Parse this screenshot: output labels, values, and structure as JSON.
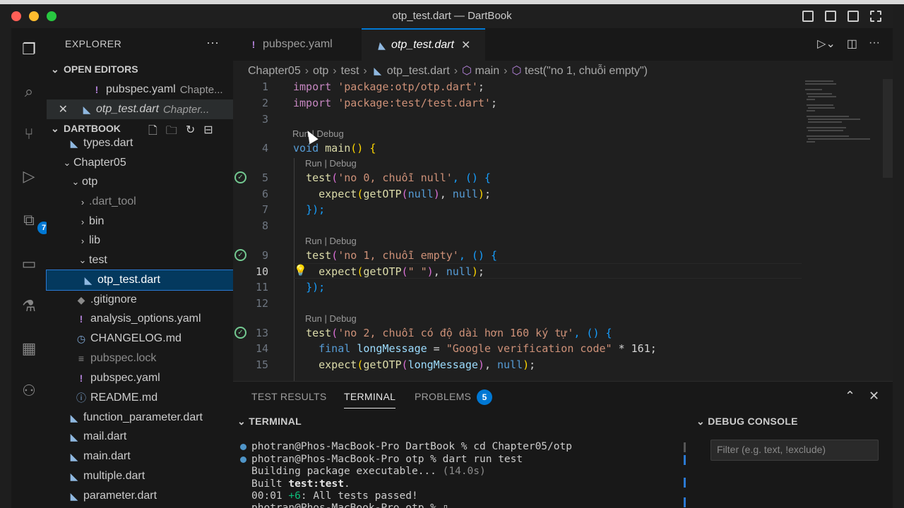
{
  "window": {
    "title": "otp_test.dart — DartBook"
  },
  "activity": {
    "extensions_badge": "7"
  },
  "sidebar": {
    "header": "EXPLORER",
    "more": "···",
    "open_editors_label": "OPEN EDITORS",
    "open_editors": [
      {
        "name": "pubspec.yaml",
        "desc": "Chapte..."
      },
      {
        "name": "otp_test.dart",
        "desc": "Chapter..."
      }
    ],
    "workspace_label": "DARTBOOK",
    "tree": [
      {
        "name": "types.dart"
      },
      {
        "name": "Chapter05"
      },
      {
        "name": "otp"
      },
      {
        "name": ".dart_tool"
      },
      {
        "name": "bin"
      },
      {
        "name": "lib"
      },
      {
        "name": "test"
      },
      {
        "name": "otp_test.dart"
      },
      {
        "name": ".gitignore"
      },
      {
        "name": "analysis_options.yaml"
      },
      {
        "name": "CHANGELOG.md"
      },
      {
        "name": "pubspec.lock"
      },
      {
        "name": "pubspec.yaml"
      },
      {
        "name": "README.md"
      },
      {
        "name": "function_parameter.dart"
      },
      {
        "name": "mail.dart"
      },
      {
        "name": "main.dart"
      },
      {
        "name": "multiple.dart"
      },
      {
        "name": "parameter.dart"
      }
    ]
  },
  "editor": {
    "tabs": [
      {
        "label": "pubspec.yaml"
      },
      {
        "label": "otp_test.dart"
      }
    ],
    "breadcrumbs": [
      "Chapter05",
      "otp",
      "test",
      "otp_test.dart",
      "main",
      "test(\"no 1, chuỗi empty\")"
    ],
    "codelens": "Run | Debug",
    "line_numbers": [
      "1",
      "2",
      "3",
      "4",
      "5",
      "6",
      "7",
      "8",
      "9",
      "10",
      "11",
      "12",
      "13",
      "14",
      "15"
    ],
    "code": {
      "l1_kw": "import",
      "l1_str": "'package:otp/otp.dart'",
      "l1_end": ";",
      "l2_kw": "import",
      "l2_str": "'package:test/test.dart'",
      "l2_end": ";",
      "l4_kw": "void",
      "l4_fn": "main",
      "l4_rest": "() {",
      "l5_fn": "test",
      "l5_str": "'no 0, chuỗi null'",
      "l5_rest": ", () {",
      "l6_fn": "expect",
      "l6_fn2": "getOTP",
      "l6_a": "null",
      "l6_b": "null",
      "l6_end": ";",
      "l7": "});",
      "l9_fn": "test",
      "l9_str": "'no 1, chuỗi empty'",
      "l9_rest": ", () {",
      "l10_fn": "expect",
      "l10_fn2": "getOTP",
      "l10_str": "\" \"",
      "l10_b": "null",
      "l10_end": ";",
      "l11": "});",
      "l13_fn": "test",
      "l13_str": "'no 2, chuỗi có độ dài hơn 160 ký tự'",
      "l13_rest": ", () {",
      "l14_kw": "final",
      "l14_var": "longMessage",
      "l14_eq": " = ",
      "l14_str": "\"Google verification code\"",
      "l14_rest": " * 161;",
      "l15_fn": "expect",
      "l15_fn2": "getOTP",
      "l15_var": "longMessage",
      "l15_b": "null",
      "l15_end": ";"
    }
  },
  "panel": {
    "tabs": [
      "TEST RESULTS",
      "TERMINAL",
      "PROBLEMS"
    ],
    "problems_count": "5",
    "terminal_header": "TERMINAL",
    "debug_header": "DEBUG CONSOLE",
    "filter_placeholder": "Filter (e.g. text, !exclude)",
    "terminal": {
      "l1": "photran@Phos-MacBook-Pro DartBook % cd Chapter05/otp",
      "l2": "photran@Phos-MacBook-Pro otp % dart run test",
      "l3a": "Building package executable... ",
      "l3b": "(14.0s)",
      "l4a": "Built ",
      "l4b": "test:test",
      "l4c": ".",
      "l5a": "00:01 ",
      "l5b": "+6",
      "l5c": ": All tests passed!",
      "l6": "photran@Phos-MacBook-Pro otp % "
    }
  }
}
